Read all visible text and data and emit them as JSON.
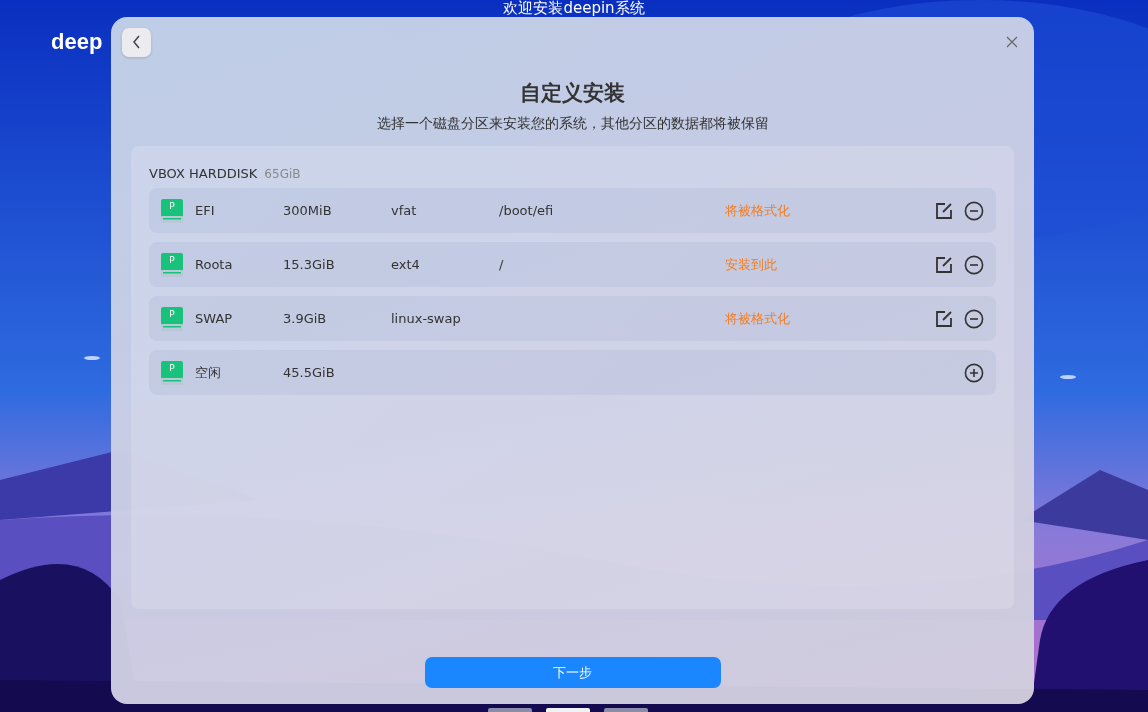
{
  "desktop": {
    "heading": "欢迎安装deepin系统",
    "logo": "deep",
    "pages": [
      {
        "selected": false
      },
      {
        "selected": true
      },
      {
        "selected": false
      }
    ]
  },
  "dialog": {
    "title": "自定义安装",
    "subtitle": "选择一个磁盘分区来安装您的系统，其他分区的数据都将被保留",
    "disk": {
      "name": "VBOX HARDDISK",
      "size": "65GiB"
    },
    "partitions": [
      {
        "kind": "used",
        "icon_letter": "P",
        "name": "EFI",
        "size": "300MiB",
        "filesystem": "vfat",
        "mount": "/boot/efi",
        "status": "将被格式化"
      },
      {
        "kind": "used",
        "icon_letter": "P",
        "name": "Roota",
        "size": "15.3GiB",
        "filesystem": "ext4",
        "mount": "/",
        "status": "安装到此"
      },
      {
        "kind": "used",
        "icon_letter": "P",
        "name": "SWAP",
        "size": "3.9GiB",
        "filesystem": "linux-swap",
        "status": "将被格式化"
      },
      {
        "kind": "free",
        "icon_letter": "P",
        "name": "空闲",
        "size": "45.5GiB"
      }
    ],
    "next_button": "下一步"
  }
}
